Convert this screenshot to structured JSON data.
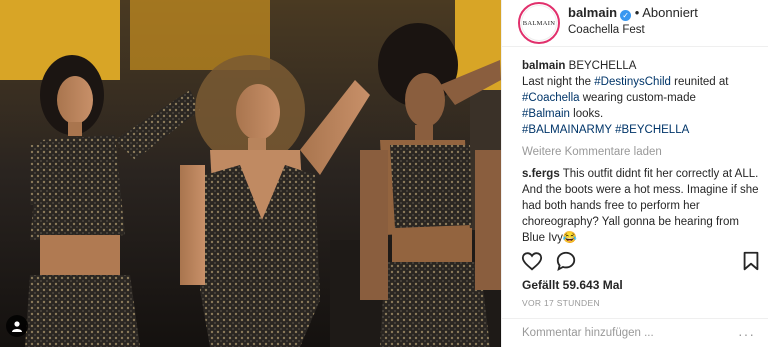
{
  "post": {
    "tag_icon": "person-icon",
    "account": "balmain",
    "avatar_text": "BALMAIN",
    "verified_icon": "verified-check-icon",
    "separator": "•",
    "follow_status": "Abonniert",
    "location": "Coachella Fest"
  },
  "caption": {
    "username": "balmain",
    "lines": [
      {
        "text": "BEYCHELLA"
      },
      {
        "parts": [
          "Last night the ",
          "#DestinysChild",
          " reunited at"
        ]
      },
      {
        "parts": [
          "#Coachella",
          " wearing custom-made"
        ]
      },
      {
        "parts": [
          "#Balmain",
          " looks."
        ]
      },
      {
        "parts": [
          "#BALMAINARMY",
          " ",
          "#BEYCHELLA"
        ]
      }
    ]
  },
  "load_more": "Weitere Kommentare laden",
  "comment": {
    "username": "s.fergs",
    "text": "This outfit didnt fit her correctly at ALL. And the boots were a hot mess. Imagine if she had both hands free to perform her choreography? Yall gonna be hearing from Blue Ivy😂"
  },
  "actions": {
    "like_icon": "heart-icon",
    "comment_icon": "comment-bubble-icon",
    "save_icon": "bookmark-icon"
  },
  "likes": "Gefällt 59.643 Mal",
  "time": "VOR 17 STUNDEN",
  "add_comment_placeholder": "Kommentar hinzufügen ...",
  "more_icon": "more-options-icon",
  "more_text": "···"
}
